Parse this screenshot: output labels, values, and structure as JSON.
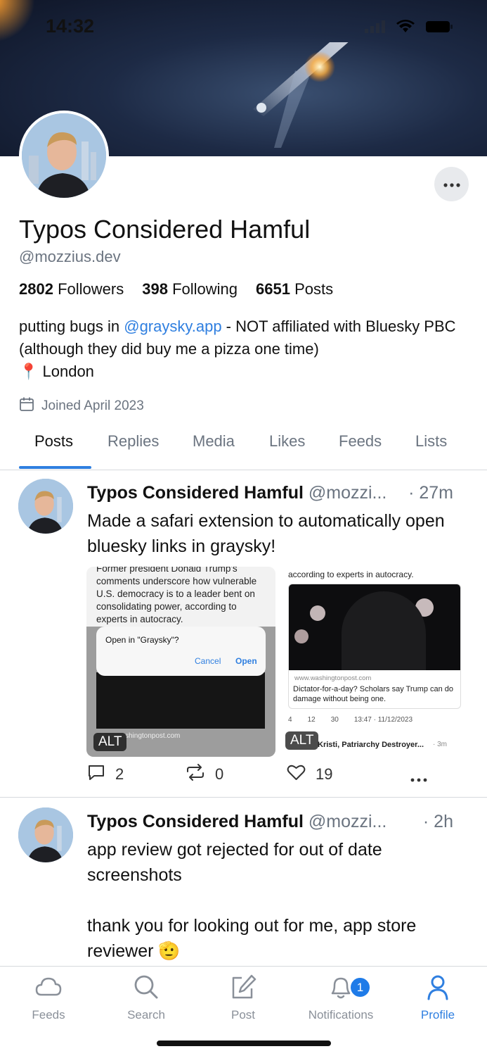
{
  "status_bar": {
    "time": "14:32"
  },
  "profile": {
    "display_name": "Typos Considered Hamful",
    "handle": "@mozzius.dev",
    "followers_count": "2802",
    "followers_label": "Followers",
    "following_count": "398",
    "following_label": "Following",
    "posts_count": "6651",
    "posts_label": "Posts",
    "bio_prefix": "putting bugs in ",
    "bio_link": "@graysky.app",
    "bio_suffix": " - NOT affiliated with Bluesky PBC (although they did buy me a pizza one time)",
    "location": "📍 London",
    "joined": "Joined April 2023"
  },
  "tabs": [
    {
      "label": "Posts",
      "active": true
    },
    {
      "label": "Replies"
    },
    {
      "label": "Media"
    },
    {
      "label": "Likes"
    },
    {
      "label": "Feeds"
    },
    {
      "label": "Lists"
    }
  ],
  "posts": [
    {
      "author": "Typos Considered Hamful",
      "handle": "@mozzi...",
      "time": "· 27m",
      "text": "Made a safari extension to automatically open bluesky links in graysky!",
      "images": [
        {
          "alt_badge": "ALT",
          "article_text": "Former president Donald Trump's comments underscore how vulnerable U.S. democracy is to a leader bent on consolidating power, according to experts in autocracy.",
          "dialog_title": "Open in \"Graysky\"?",
          "dialog_cancel": "Cancel",
          "dialog_open": "Open",
          "url": "shingtonpost.com"
        },
        {
          "alt_badge": "ALT",
          "article_text": "according to experts in autocracy.",
          "url": "www.washingtonpost.com",
          "headline": "Dictator-for-a-day? Scholars say Trump can do damage without being one.",
          "replies": "4",
          "reposts": "12",
          "likes": "30",
          "timestamp": "13:47 · 11/12/2023",
          "next_author": "Kristi, Patriarchy Destroyer...",
          "next_time": "· 3m"
        }
      ],
      "replies": "2",
      "reposts": "0",
      "likes": "19"
    },
    {
      "author": "Typos Considered Hamful",
      "handle": "@mozzi...",
      "time": "· 2h",
      "text_line1": "app review got rejected for out of date screenshots",
      "text_line2": "thank you for looking out for me, app store reviewer 🫡"
    }
  ],
  "bottom_nav": [
    {
      "label": "Feeds",
      "icon": "cloud-icon"
    },
    {
      "label": "Search",
      "icon": "search-icon"
    },
    {
      "label": "Post",
      "icon": "compose-icon"
    },
    {
      "label": "Notifications",
      "icon": "bell-icon",
      "badge": "1"
    },
    {
      "label": "Profile",
      "icon": "person-icon",
      "active": true
    }
  ],
  "colors": {
    "accent": "#2f7fe0",
    "muted": "#6b7480",
    "badge": "#1f7be8"
  }
}
